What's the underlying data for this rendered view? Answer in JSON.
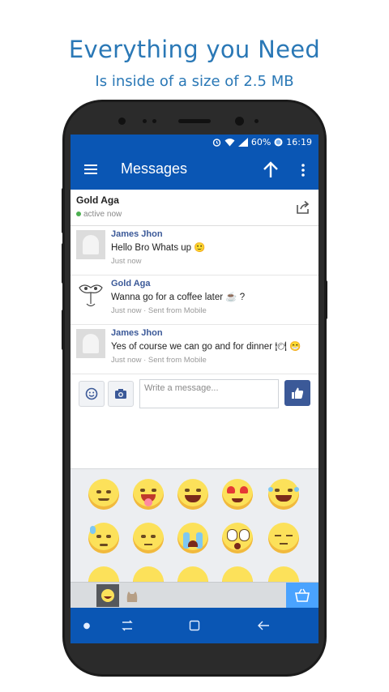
{
  "promo": {
    "headline": "Everything you Need",
    "subheadline": "Is inside of a size of 2.5 MB"
  },
  "statusbar": {
    "battery": "60%",
    "time": "16:19"
  },
  "appbar": {
    "title": "Messages"
  },
  "contact": {
    "name": "Gold Aga",
    "status": "active now"
  },
  "messages": [
    {
      "sender": "James Jhon",
      "text": "Hello Bro Whats up 🙂",
      "meta": "Just now"
    },
    {
      "sender": "Gold Aga",
      "text": "Wanna go for a coffee later ☕ ?",
      "meta": "Just now · Sent from Mobile"
    },
    {
      "sender": "James Jhon",
      "text": "Yes of course we can go and for dinner 🍽 😁",
      "meta": "Just now · Sent from Mobile"
    }
  ],
  "composer": {
    "placeholder": "Write a message..."
  },
  "emoji_panel": {
    "emoji_names": [
      "smile",
      "tongue-out",
      "grin",
      "heart-eyes",
      "laughing",
      "sweat",
      "confused",
      "crying",
      "surprised",
      "sleepy"
    ]
  },
  "colors": {
    "brand": "#0a56b4",
    "like": "#3b5998",
    "headline": "#2a78b6"
  }
}
